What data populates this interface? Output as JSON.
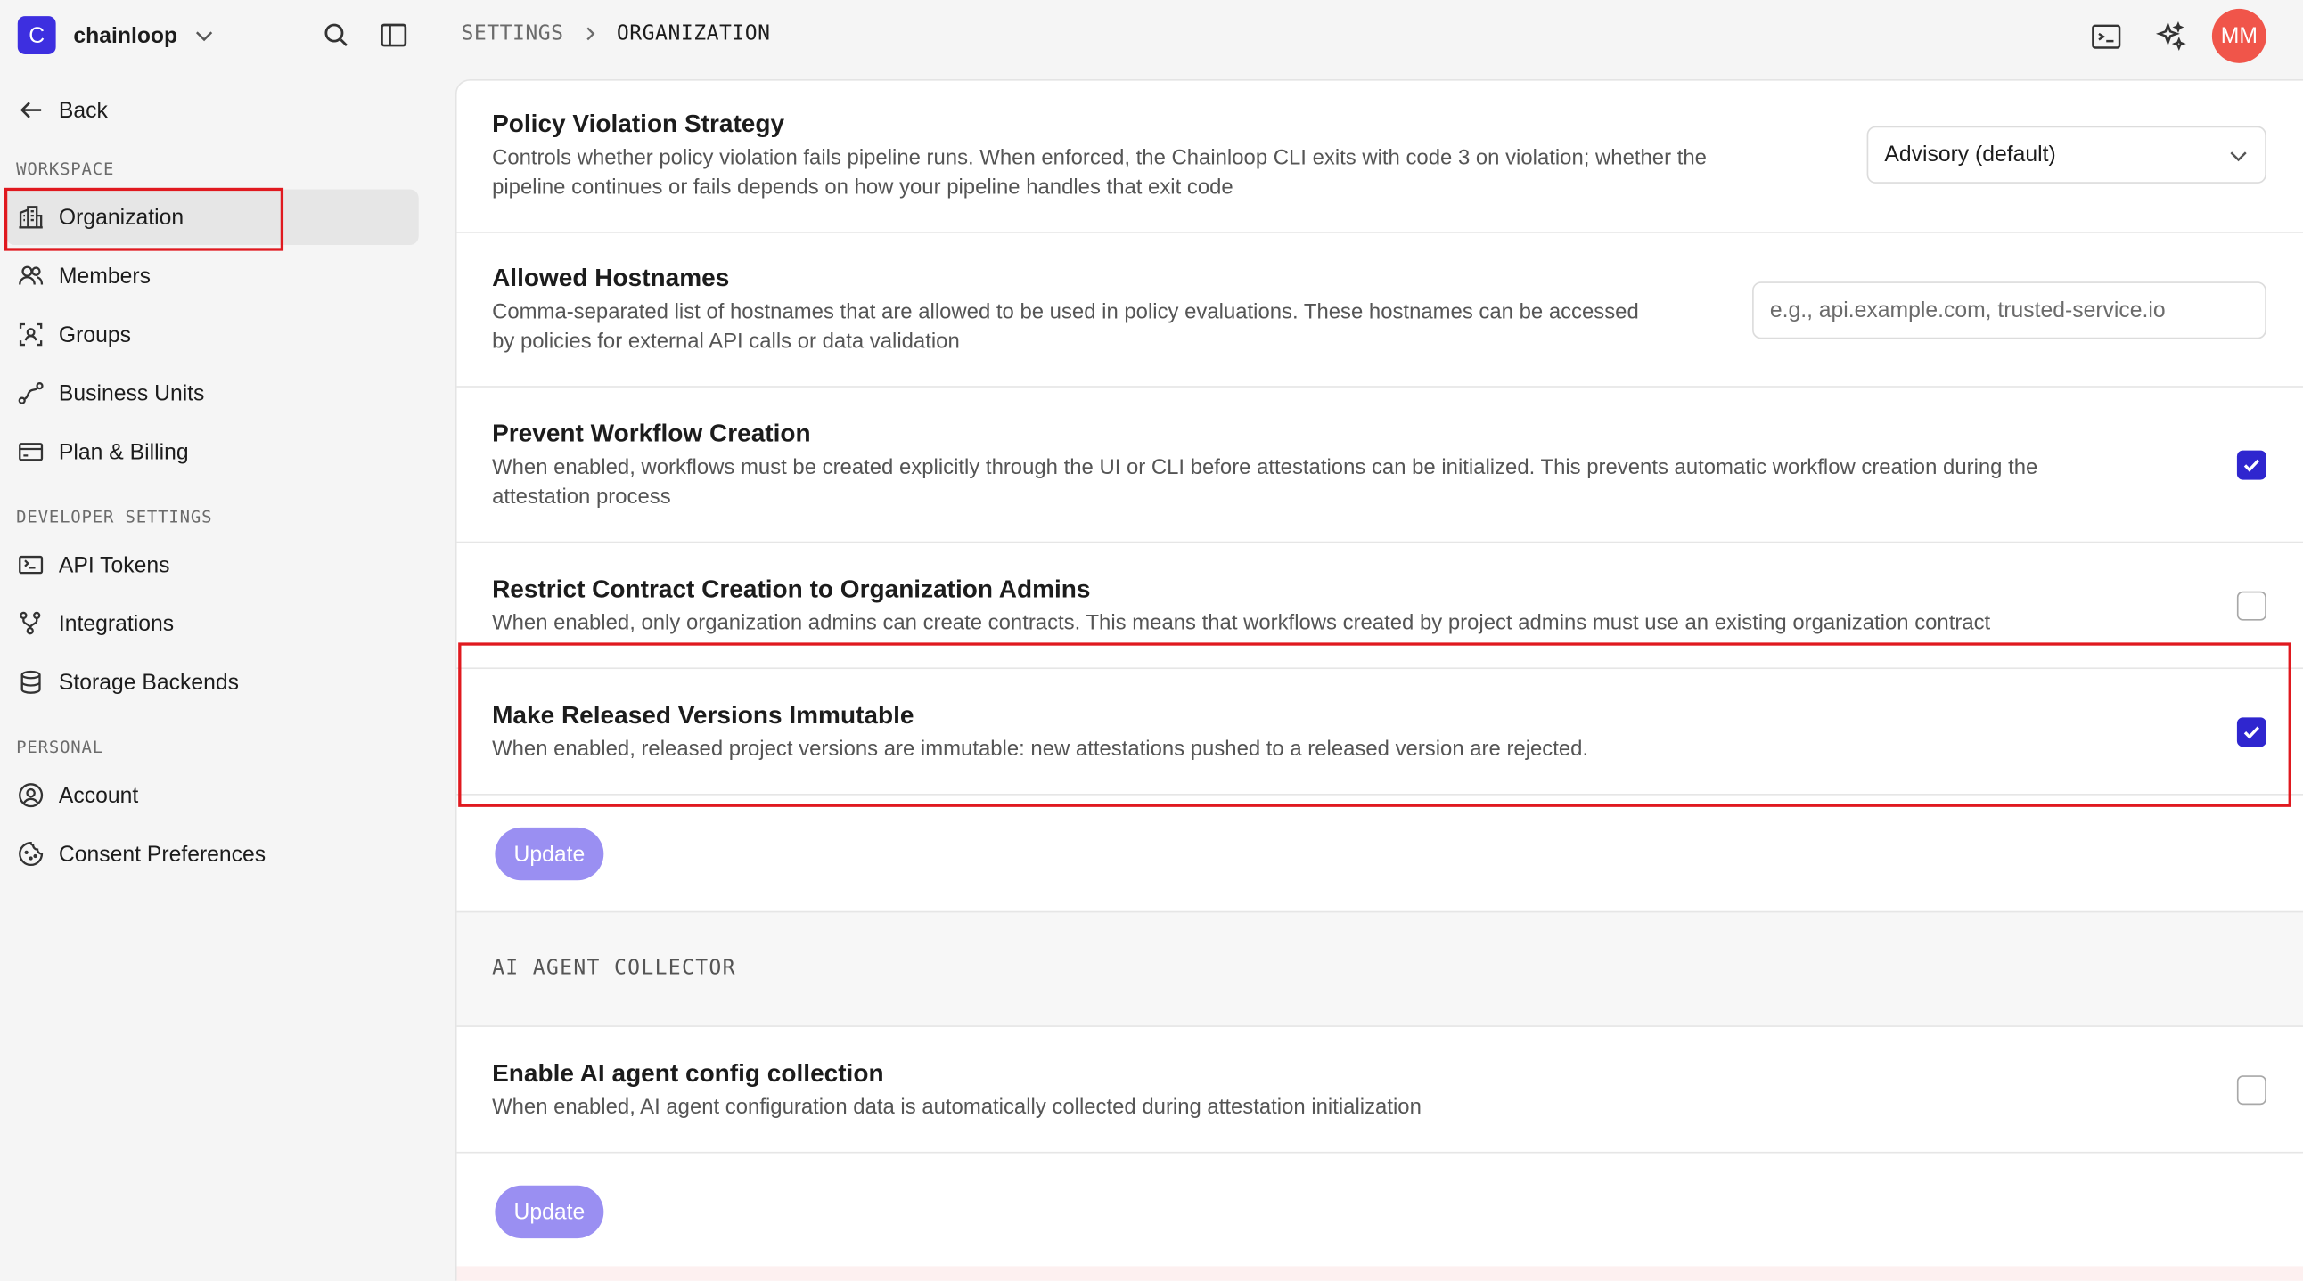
{
  "sidebar": {
    "org": {
      "initial": "C",
      "name": "chainloop"
    },
    "back_label": "Back",
    "sections": {
      "workspace": "WORKSPACE",
      "developer": "DEVELOPER SETTINGS",
      "personal": "PERSONAL"
    },
    "items": [
      {
        "label": "Organization",
        "icon": "building-icon",
        "active": true
      },
      {
        "label": "Members",
        "icon": "users-icon"
      },
      {
        "label": "Groups",
        "icon": "group-icon"
      },
      {
        "label": "Business Units",
        "icon": "route-icon"
      },
      {
        "label": "Plan & Billing",
        "icon": "credit-card-icon"
      },
      {
        "label": "API Tokens",
        "icon": "token-icon"
      },
      {
        "label": "Integrations",
        "icon": "integrations-icon"
      },
      {
        "label": "Storage Backends",
        "icon": "database-icon"
      },
      {
        "label": "Account",
        "icon": "user-circle-icon"
      },
      {
        "label": "Consent Preferences",
        "icon": "cookie-icon"
      }
    ]
  },
  "header": {
    "breadcrumb": [
      "SETTINGS",
      "ORGANIZATION"
    ],
    "avatar_initials": "MM"
  },
  "settings": {
    "policy_violation": {
      "title": "Policy Violation Strategy",
      "description_line1": "Controls whether policy violation fails pipeline runs. When enforced, the Chainloop CLI exits with code 3 on violation; whether the",
      "description_line2": "pipeline continues or fails depends on how your pipeline handles that exit code",
      "selected": "Advisory (default)"
    },
    "allowed_hostnames": {
      "title": "Allowed Hostnames",
      "description_line1": "Comma-separated list of hostnames that are allowed to be used in policy evaluations. These hostnames can be accessed",
      "description_line2": "by policies for external API calls or data validation",
      "placeholder": "e.g., api.example.com, trusted-service.io",
      "value": ""
    },
    "prevent_workflow": {
      "title": "Prevent Workflow Creation",
      "description_line1": "When enabled, workflows must be created explicitly through the UI or CLI before attestations can be initialized. This prevents automatic workflow creation during the",
      "description_line2": "attestation process",
      "checked": true
    },
    "restrict_contract": {
      "title": "Restrict Contract Creation to Organization Admins",
      "description": "When enabled, only organization admins can create contracts. This means that workflows created by project admins must use an existing organization contract",
      "checked": false
    },
    "immutable_versions": {
      "title": "Make Released Versions Immutable",
      "description": "When enabled, released project versions are immutable: new attestations pushed to a released version are rejected.",
      "checked": true
    },
    "update_label": "Update"
  },
  "ai_agent": {
    "section_title": "AI AGENT COLLECTOR",
    "enable_collection": {
      "title": "Enable AI agent config collection",
      "description": "When enabled, AI agent configuration data is automatically collected during attestation initialization",
      "checked": false
    },
    "update_label": "Update"
  },
  "colors": {
    "accent": "#2f26cf",
    "brand": "#3d2fe0",
    "button_disabled": "#9a8ff2",
    "avatar": "#f0554a",
    "highlight": "#e0191f"
  }
}
